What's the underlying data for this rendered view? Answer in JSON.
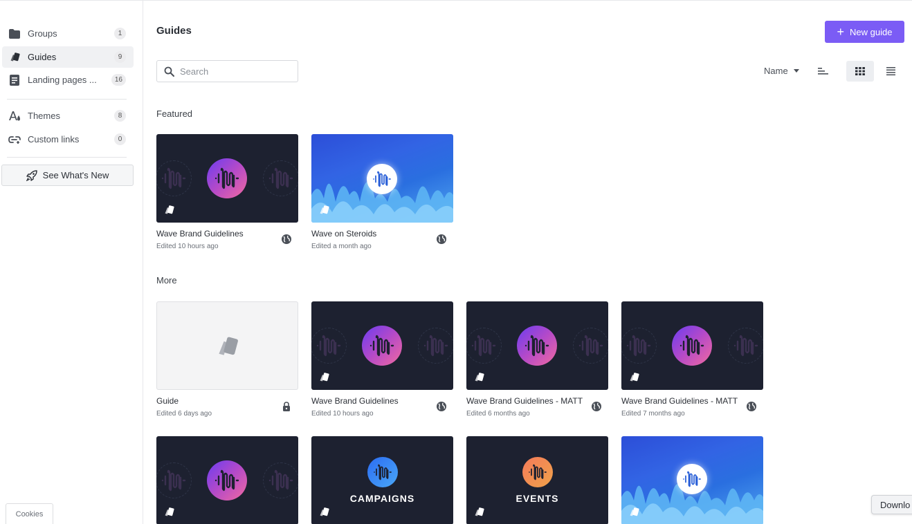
{
  "sidebar": {
    "items": [
      {
        "label": "Groups",
        "count": "1",
        "icon": "folder-icon"
      },
      {
        "label": "Guides",
        "count": "9",
        "icon": "guide-icon"
      },
      {
        "label": "Landing pages ...",
        "count": "16",
        "icon": "landing-page-icon"
      },
      {
        "label": "Themes",
        "count": "8",
        "icon": "theme-icon"
      },
      {
        "label": "Custom links",
        "count": "0",
        "icon": "link-icon"
      }
    ],
    "whats_new_label": "See What's New",
    "cookies_label": "Cookies"
  },
  "header": {
    "title": "Guides",
    "new_guide_label": "New guide"
  },
  "toolbar": {
    "search_placeholder": "Search",
    "sort_label": "Name"
  },
  "sections": {
    "featured_label": "Featured",
    "more_label": "More"
  },
  "featured": [
    {
      "title": "Wave Brand Guidelines",
      "edited": "Edited 10 hours ago",
      "visibility": "public"
    },
    {
      "title": "Wave on Steroids",
      "edited": "Edited a month ago",
      "visibility": "public"
    }
  ],
  "more": [
    {
      "title": "Guide",
      "edited": "Edited 6 days ago",
      "visibility": "private"
    },
    {
      "title": "Wave Brand Guidelines",
      "edited": "Edited 10 hours ago",
      "visibility": "public"
    },
    {
      "title": "Wave Brand Guidelines - MATT",
      "edited": "Edited 6 months ago",
      "visibility": "public"
    },
    {
      "title": "Wave Brand Guidelines - MATT",
      "edited": "Edited 7 months ago",
      "visibility": "public"
    }
  ],
  "row3": [
    {
      "thumb_text": ""
    },
    {
      "thumb_text": "CAMPAIGNS"
    },
    {
      "thumb_text": "EVENTS"
    },
    {
      "thumb_text": ""
    }
  ],
  "download_label": "Downlo",
  "colors": {
    "accent": "#7b5cf5",
    "card_dark": "#1d2130"
  }
}
